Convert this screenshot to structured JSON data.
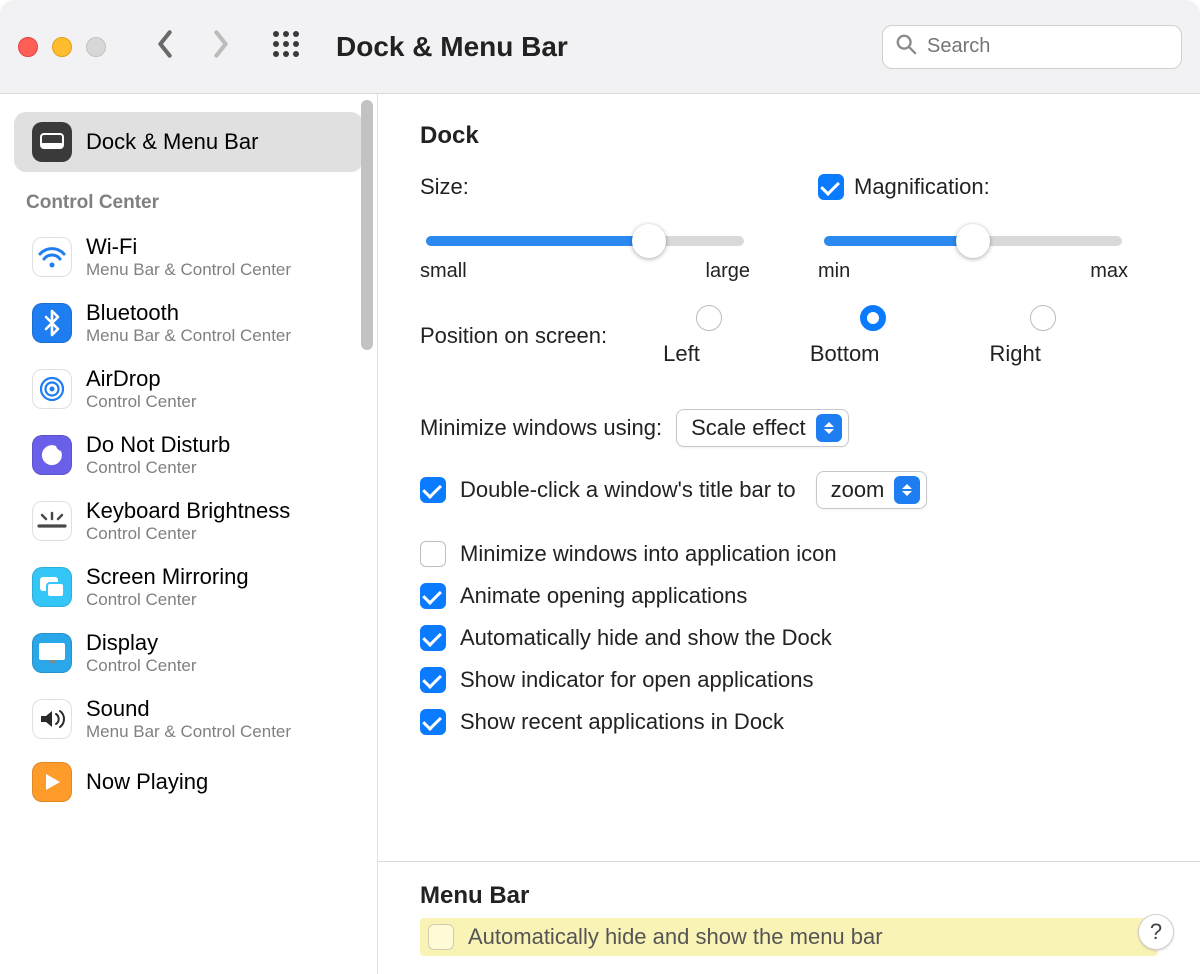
{
  "title": "Dock & Menu Bar",
  "search": {
    "placeholder": "Search"
  },
  "sidebar": {
    "selected": {
      "title": "Dock & Menu Bar",
      "icon": "dock-menubar-icon"
    },
    "group_label": "Control Center",
    "items": [
      {
        "title": "Wi-Fi",
        "sub": "Menu Bar & Control Center",
        "icon": "wifi-icon",
        "icon_bg": "#ffffff",
        "icon_fg": "#1e7df0"
      },
      {
        "title": "Bluetooth",
        "sub": "Menu Bar & Control Center",
        "icon": "bluetooth-icon",
        "icon_bg": "#1e7df0",
        "icon_fg": "#ffffff"
      },
      {
        "title": "AirDrop",
        "sub": "Control Center",
        "icon": "airdrop-icon",
        "icon_bg": "#ffffff",
        "icon_fg": "#1e7df0"
      },
      {
        "title": "Do Not Disturb",
        "sub": "Control Center",
        "icon": "dnd-icon",
        "icon_bg": "#6a5fe8",
        "icon_fg": "#ffffff"
      },
      {
        "title": "Keyboard Brightness",
        "sub": "Control Center",
        "icon": "keyboard-brightness-icon",
        "icon_bg": "#ffffff",
        "icon_fg": "#4a4a4a"
      },
      {
        "title": "Screen Mirroring",
        "sub": "Control Center",
        "icon": "screen-mirroring-icon",
        "icon_bg": "#34c6f6",
        "icon_fg": "#ffffff"
      },
      {
        "title": "Display",
        "sub": "Control Center",
        "icon": "display-icon",
        "icon_bg": "#2aa7e8",
        "icon_fg": "#ffffff"
      },
      {
        "title": "Sound",
        "sub": "Menu Bar & Control Center",
        "icon": "sound-icon",
        "icon_bg": "#ffffff",
        "icon_fg": "#2a2a2a"
      },
      {
        "title": "Now Playing",
        "sub": "",
        "icon": "now-playing-icon",
        "icon_bg": "#ff9b2a",
        "icon_fg": "#ffffff"
      }
    ]
  },
  "main": {
    "dock": {
      "title": "Dock",
      "size_label": "Size:",
      "size_min": "small",
      "size_max": "large",
      "size_pct": 70,
      "mag_checked": true,
      "mag_label": "Magnification:",
      "mag_min": "min",
      "mag_max": "max",
      "mag_pct": 50,
      "position_label": "Position on screen:",
      "position_options": [
        "Left",
        "Bottom",
        "Right"
      ],
      "position_selected": 1,
      "minimize_label": "Minimize windows using:",
      "minimize_value": "Scale effect",
      "titlebar_check": true,
      "titlebar_text": "Double-click a window's title bar to",
      "titlebar_value": "zoom",
      "options": [
        {
          "checked": false,
          "text": "Minimize windows into application icon"
        },
        {
          "checked": true,
          "text": "Animate opening applications"
        },
        {
          "checked": true,
          "text": "Automatically hide and show the Dock"
        },
        {
          "checked": true,
          "text": "Show indicator for open applications"
        },
        {
          "checked": true,
          "text": "Show recent applications in Dock"
        }
      ]
    },
    "menubar": {
      "title": "Menu Bar",
      "auto_hide": {
        "checked": false,
        "text": "Automatically hide and show the menu bar"
      }
    },
    "help_label": "?"
  }
}
